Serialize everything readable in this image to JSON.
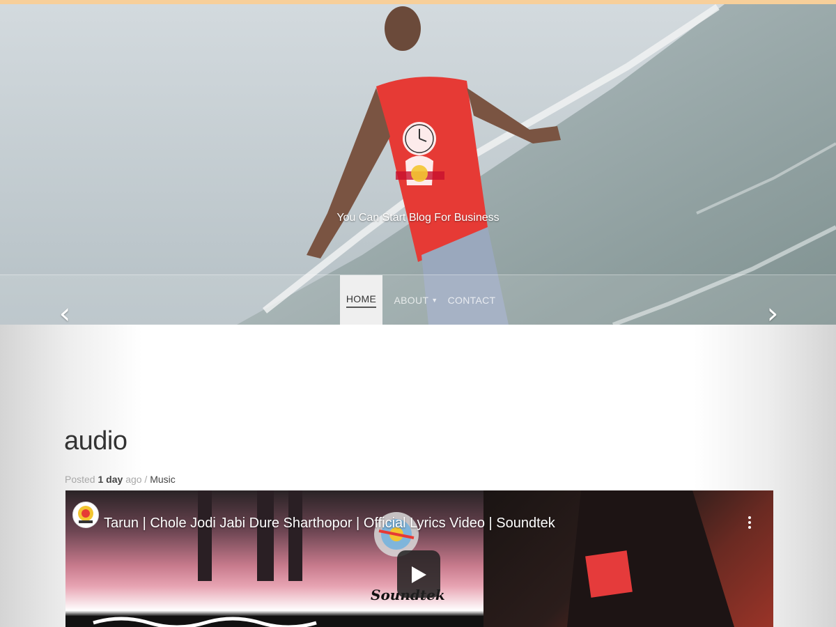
{
  "hero": {
    "tagline": "You Can Start Blog For Business",
    "nav": {
      "home": "HOME",
      "about": "ABOUT",
      "contact": "CONTACT"
    },
    "prev_arrow": "‹",
    "next_arrow": "›"
  },
  "post": {
    "title": "audio",
    "meta": {
      "posted": "Posted",
      "time_value": "1 day",
      "ago": "ago /",
      "category": "Music"
    }
  },
  "video": {
    "title": "Tarun | Chole Jodi Jabi Dure Sharthopor | Official Lyrics Video | Soundtek",
    "channel_brand": "Soundtek",
    "play_icon": "play-icon",
    "menu_icon": "more-vertical-icon"
  },
  "colors": {
    "top_strip": "#f7cf9a",
    "nav_active_bg": "#efefef",
    "play_button": "#212121"
  }
}
